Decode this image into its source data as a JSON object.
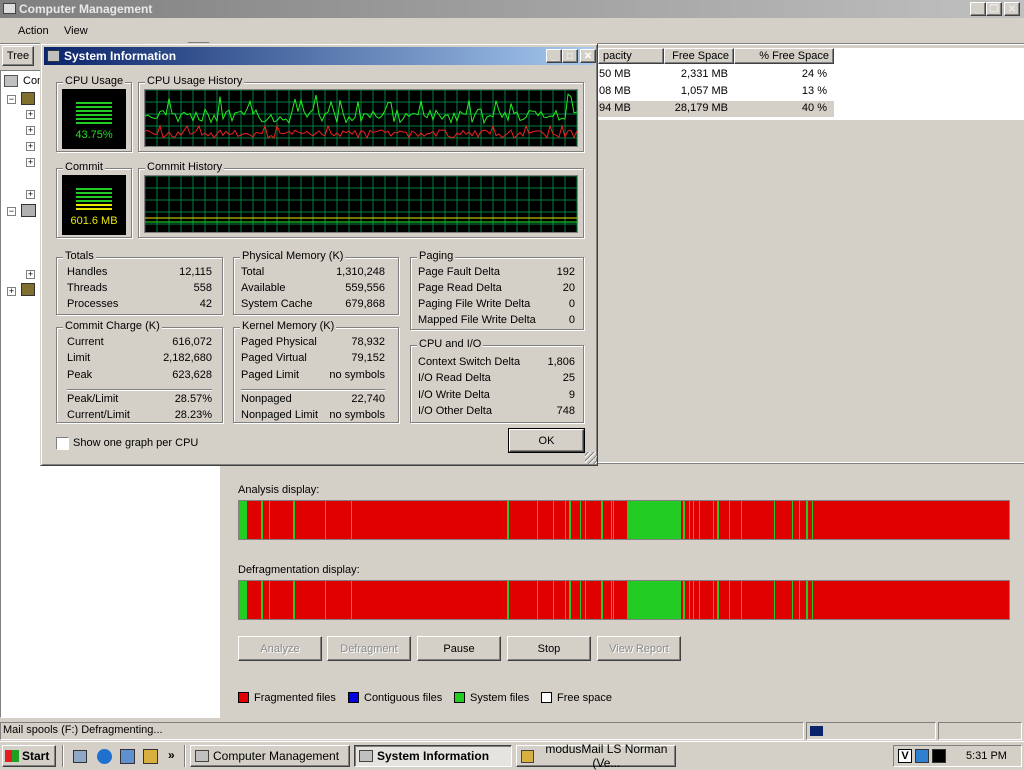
{
  "main_window": {
    "title": "Computer Management",
    "menu": [
      "Action",
      "View"
    ],
    "tree_tab": "Tree",
    "tree_partial_label": "Con"
  },
  "volume_list": {
    "headers": [
      "pacity",
      "Free Space",
      "% Free Space"
    ],
    "rows": [
      {
        "capacity": "50 MB",
        "free": "2,331 MB",
        "pct": "24 %"
      },
      {
        "capacity": "08 MB",
        "free": "1,057 MB",
        "pct": "13 %"
      },
      {
        "capacity": "94 MB",
        "free": "28,179 MB",
        "pct": "40 %"
      }
    ]
  },
  "defrag": {
    "analysis_label": "Analysis display:",
    "defrag_label": "Defragmentation display:",
    "buttons": {
      "analyze": "Analyze",
      "defragment": "Defragment",
      "pause": "Pause",
      "stop": "Stop",
      "view_report": "View Report"
    },
    "legend": [
      {
        "label": "Fragmented files",
        "color": "#e00000"
      },
      {
        "label": "Contiguous files",
        "color": "#0000e0"
      },
      {
        "label": "System files",
        "color": "#22cc22"
      },
      {
        "label": "Free space",
        "color": "#ffffff"
      }
    ]
  },
  "dialog": {
    "title": "System Information",
    "cpu_usage_label": "CPU Usage",
    "cpu_usage_value": "43.75%",
    "cpu_history_label": "CPU Usage History",
    "commit_label": "Commit",
    "commit_value": "601.6 MB",
    "commit_history_label": "Commit History",
    "totals": {
      "label": "Totals",
      "rows": [
        {
          "k": "Handles",
          "v": "12,115"
        },
        {
          "k": "Threads",
          "v": "558"
        },
        {
          "k": "Processes",
          "v": "42"
        }
      ]
    },
    "physical": {
      "label": "Physical Memory (K)",
      "rows": [
        {
          "k": "Total",
          "v": "1,310,248"
        },
        {
          "k": "Available",
          "v": "559,556"
        },
        {
          "k": "System Cache",
          "v": "679,868"
        }
      ]
    },
    "paging": {
      "label": "Paging",
      "rows": [
        {
          "k": "Page Fault Delta",
          "v": "192"
        },
        {
          "k": "Page Read Delta",
          "v": "20"
        },
        {
          "k": "Paging File Write Delta",
          "v": "0"
        },
        {
          "k": "Mapped File Write Delta",
          "v": "0"
        }
      ]
    },
    "commit_charge": {
      "label": "Commit Charge (K)",
      "rows": [
        {
          "k": "Current",
          "v": "616,072"
        },
        {
          "k": "Limit",
          "v": "2,182,680"
        },
        {
          "k": "Peak",
          "v": "623,628"
        },
        {
          "k": "Peak/Limit",
          "v": "28.57%"
        },
        {
          "k": "Current/Limit",
          "v": "28.23%"
        }
      ]
    },
    "kernel": {
      "label": "Kernel Memory (K)",
      "rows": [
        {
          "k": "Paged Physical",
          "v": "78,932"
        },
        {
          "k": "Paged Virtual",
          "v": "79,152"
        },
        {
          "k": "Paged Limit",
          "v": "no symbols"
        },
        {
          "k": "Nonpaged",
          "v": "22,740"
        },
        {
          "k": "Nonpaged Limit",
          "v": "no symbols"
        }
      ]
    },
    "cpu_io": {
      "label": "CPU and I/O",
      "rows": [
        {
          "k": "Context Switch Delta",
          "v": "1,806"
        },
        {
          "k": "I/O Read Delta",
          "v": "25"
        },
        {
          "k": "I/O Write Delta",
          "v": "9"
        },
        {
          "k": "I/O Other Delta",
          "v": "748"
        }
      ]
    },
    "checkbox_label": "Show one graph per CPU",
    "ok_label": "OK"
  },
  "status_bar": {
    "text": "Mail spools (F:) Defragmenting..."
  },
  "taskbar": {
    "start": "Start",
    "items": [
      "Computer Management",
      "System Information",
      "modusMail LS Norman (Ve..."
    ],
    "clock": "5:31 PM"
  }
}
